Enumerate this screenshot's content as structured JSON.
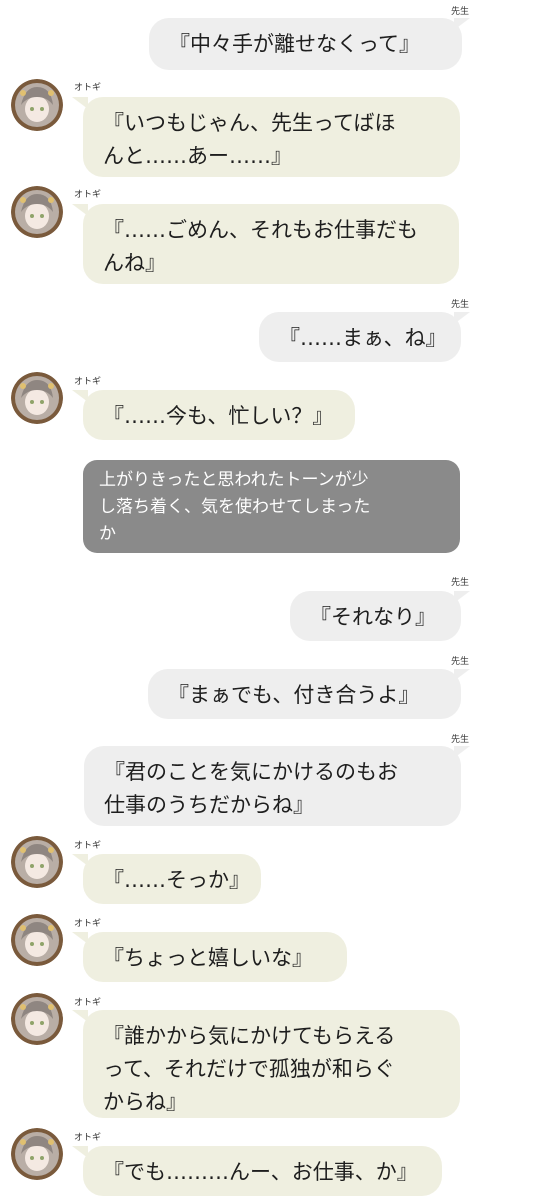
{
  "messages": [
    {
      "speaker": "先生",
      "text": "『中々手が離せなくって』"
    },
    {
      "speaker": "オトギ",
      "text": "『いつもじゃん、先生ってばほ\nんと……あー……』"
    },
    {
      "speaker": "オトギ",
      "text": "『……ごめん、それもお仕事だも\nんね』"
    },
    {
      "speaker": "先生",
      "text": "『……まぁ、ね』"
    },
    {
      "speaker": "オトギ",
      "text": "『……今も、忙しい？』"
    },
    {
      "narration": "上がりきったと思われたトーンが少\nし落ち着く、気を使わせてしまった\nか"
    },
    {
      "speaker": "先生",
      "text": "『それなり』"
    },
    {
      "speaker": "先生",
      "text": "『まぁでも、付き合うよ』"
    },
    {
      "speaker": "先生",
      "text": "『君のことを気にかけるのもお\n仕事のうちだからね』"
    },
    {
      "speaker": "オトギ",
      "text": "『……そっか』"
    },
    {
      "speaker": "オトギ",
      "text": "『ちょっと嬉しいな』"
    },
    {
      "speaker": "オトギ",
      "text": "『誰かから気にかけてもらえる\nって、それだけで孤独が和らぐ\nからね』"
    },
    {
      "speaker": "オトギ",
      "text": "『でも………んー、お仕事、か』"
    }
  ],
  "colors": {
    "teacher_bubble": "#eeeeee",
    "otogi_bubble": "#efefe0",
    "narration_bubble": "#8a8a8a"
  },
  "icons": {
    "avatar": "otogi-avatar-icon"
  }
}
